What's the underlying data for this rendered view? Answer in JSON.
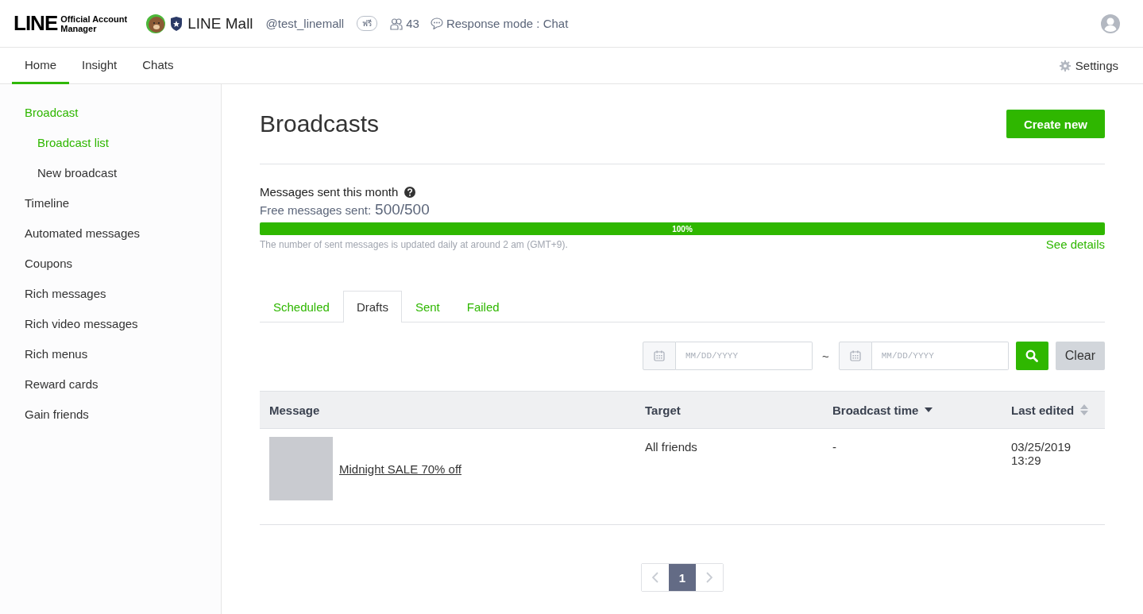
{
  "header": {
    "logo": {
      "wordmark": "LINE",
      "subtitle": "Official Account Manager"
    },
    "account_name": "LINE Mall",
    "account_id": "@test_linemall",
    "plan_badge": "ฟรี",
    "friends_count": "43",
    "response_mode": "Response mode : Chat"
  },
  "nav": {
    "tabs": [
      {
        "label": "Home",
        "selected": true
      },
      {
        "label": "Insight",
        "selected": false
      },
      {
        "label": "Chats",
        "selected": false
      }
    ],
    "settings": "Settings"
  },
  "sidebar": {
    "items": [
      {
        "label": "Broadcast",
        "selected": true,
        "children": [
          {
            "label": "Broadcast list",
            "selected": true
          },
          {
            "label": "New broadcast",
            "selected": false
          }
        ]
      },
      {
        "label": "Timeline",
        "selected": false
      },
      {
        "label": "Automated messages",
        "selected": false
      },
      {
        "label": "Coupons",
        "selected": false
      },
      {
        "label": "Rich messages",
        "selected": false
      },
      {
        "label": "Rich video messages",
        "selected": false
      },
      {
        "label": "Rich menus",
        "selected": false
      },
      {
        "label": "Reward cards",
        "selected": false
      },
      {
        "label": "Gain friends",
        "selected": false
      }
    ]
  },
  "page": {
    "title": "Broadcasts",
    "create_button": "Create new"
  },
  "usage": {
    "heading": "Messages sent this month",
    "free_label": "Free messages sent:",
    "free_value": "500/500",
    "level": 1,
    "percent": "100%",
    "note": "The number of sent messages is updated daily at around 2 am (GMT+9).",
    "details_link": "See details"
  },
  "tabs": [
    {
      "label": "Scheduled",
      "selected": false
    },
    {
      "label": "Drafts",
      "selected": true
    },
    {
      "label": "Sent",
      "selected": false
    },
    {
      "label": "Failed",
      "selected": false
    }
  ],
  "filter": {
    "start_date": {
      "placeholder": "MM/DD/YYYY"
    },
    "separator": "~",
    "end_date": {
      "placeholder": "MM/DD/YYYY"
    },
    "clear_button": "Clear"
  },
  "table": {
    "columns": [
      {
        "label": "Message"
      },
      {
        "label": "Target"
      },
      {
        "label": "Broadcast time",
        "sorted": true
      },
      {
        "label": "Last edited",
        "sorted": false
      }
    ],
    "rows": [
      {
        "message": "Midnight SALE 70% off",
        "target": "All friends",
        "broadcast_time": "-",
        "last_edited": "03/25/2019 13:29"
      }
    ]
  },
  "pagination": {
    "pages": [
      {
        "label": "1",
        "selected": true
      }
    ]
  }
}
